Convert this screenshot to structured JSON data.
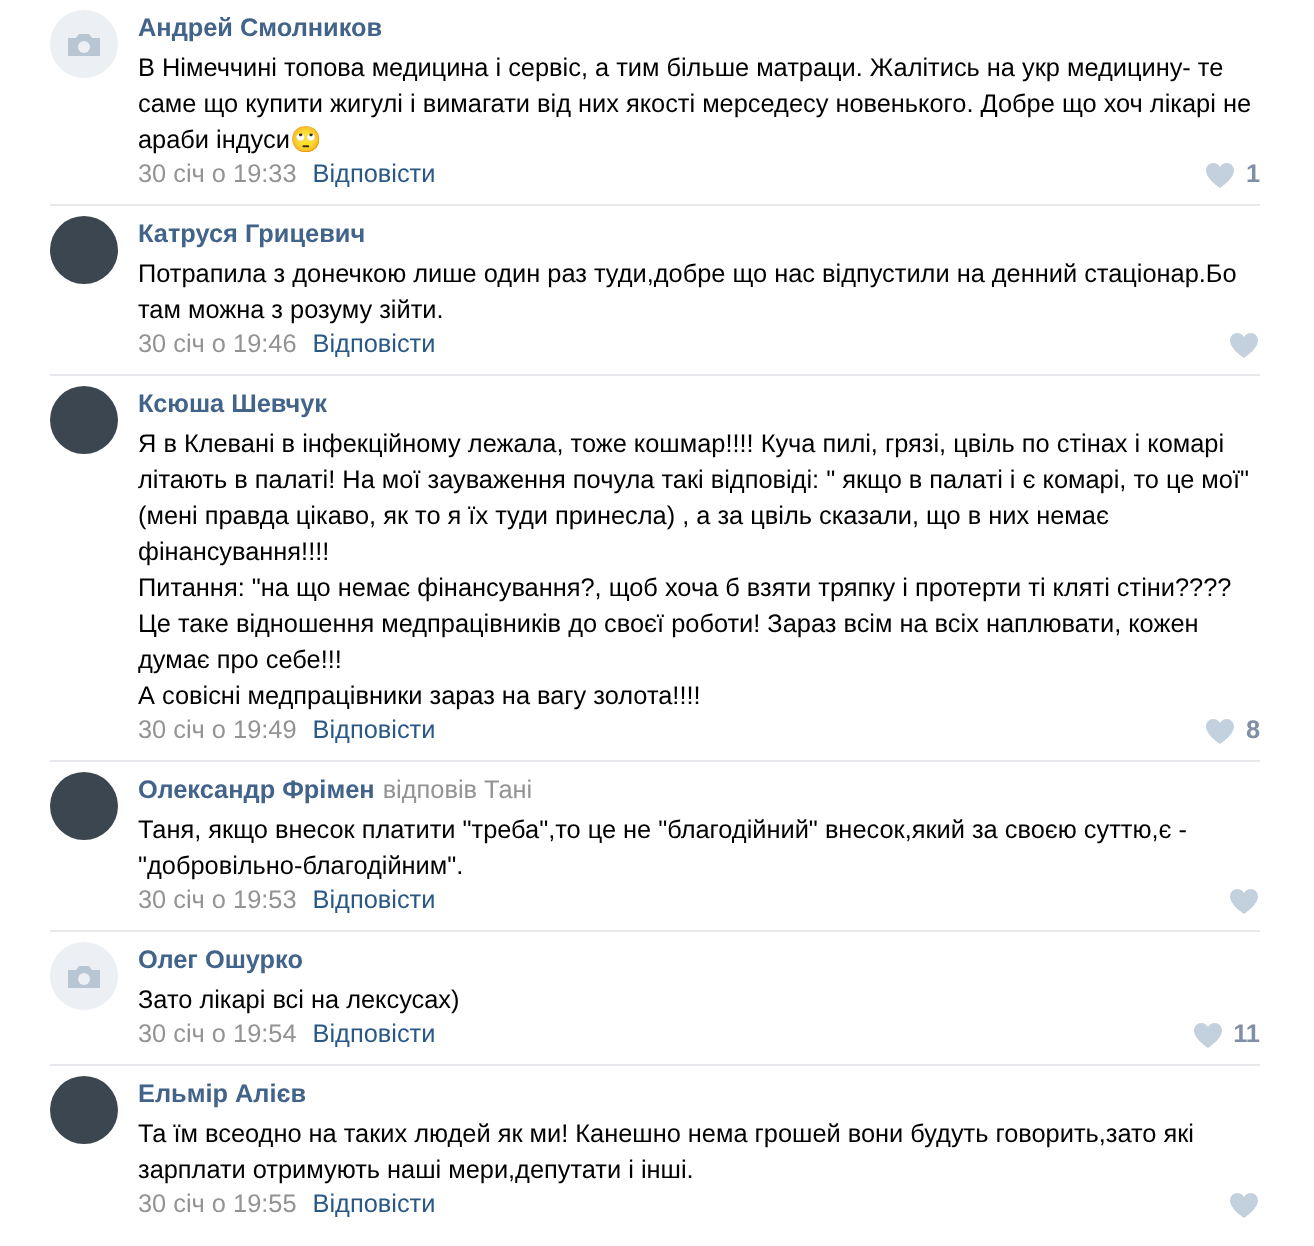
{
  "comments": [
    {
      "author": "Андрей Смолников",
      "kind": "camera",
      "text": "В Німеччині топова медицина і сервіс, а тим більше матраци. Жалітись на укр медицину- те саме що купити жигулі і вимагати від них якості мерседесу новенького. Добре що хоч лікарі не араби індуси🙄",
      "date": "30 січ о 19:33",
      "reply_link": "Відповісти",
      "likes": "1"
    },
    {
      "author": "Катруся Грицевич",
      "kind": "photo",
      "text": "Потрапила з донечкою лише один раз туди,добре що нас відпустили на денний стаціонар.Бо там можна з розуму зійти.",
      "date": "30 січ о 19:46",
      "reply_link": "Відповісти"
    },
    {
      "author": "Ксюша Шевчук",
      "kind": "photo",
      "text": "Я в Клевані в інфекційному лежала, тоже кошмар!!!! Куча пилі, грязі, цвіль по стінах і комарі літають в палаті! На мої зауваження почула такі відповіді: \" якщо в палаті і є комарі, то це мої\" (мені правда цікаво, як то я їх туди принесла) , а за цвіль сказали, що в них немає фінансування!!!!\nПитання: \"на що немає фінансування?, щоб хоча б взяти тряпку і протерти ті кляті стіни????\nЦе таке відношення медпрацівників до своєї роботи! Зараз всім на всіх наплювати, кожен думає про себе!!!\nА совісні медпрацівники зараз на вагу золота!!!!",
      "date": "30 січ о 19:49",
      "reply_link": "Відповісти",
      "likes": "8"
    },
    {
      "author": "Олександр Фрімен",
      "reply_to": "відповів Тані",
      "kind": "photo",
      "text": "Таня, якщо внесок платити \"треба\",то це не \"благодійний\" внесок,який за своєю суттю,є - \"добровільно-благодійним\".",
      "date": "30 січ о 19:53",
      "reply_link": "Відповісти"
    },
    {
      "author": "Олег Ошурко",
      "kind": "camera",
      "text": "Зато лікарі всі на лексусах)",
      "date": "30 січ о 19:54",
      "reply_link": "Відповісти",
      "likes": "11"
    },
    {
      "author": "Ельмір Алієв",
      "kind": "photo",
      "text": "Та їм всеодно на таких людей як ми! Канешно нема грошей вони будуть говорить,зато які зарплати отримують наші мери,депутати і інші.",
      "date": "30 січ о 19:55",
      "reply_link": "Відповісти"
    }
  ]
}
